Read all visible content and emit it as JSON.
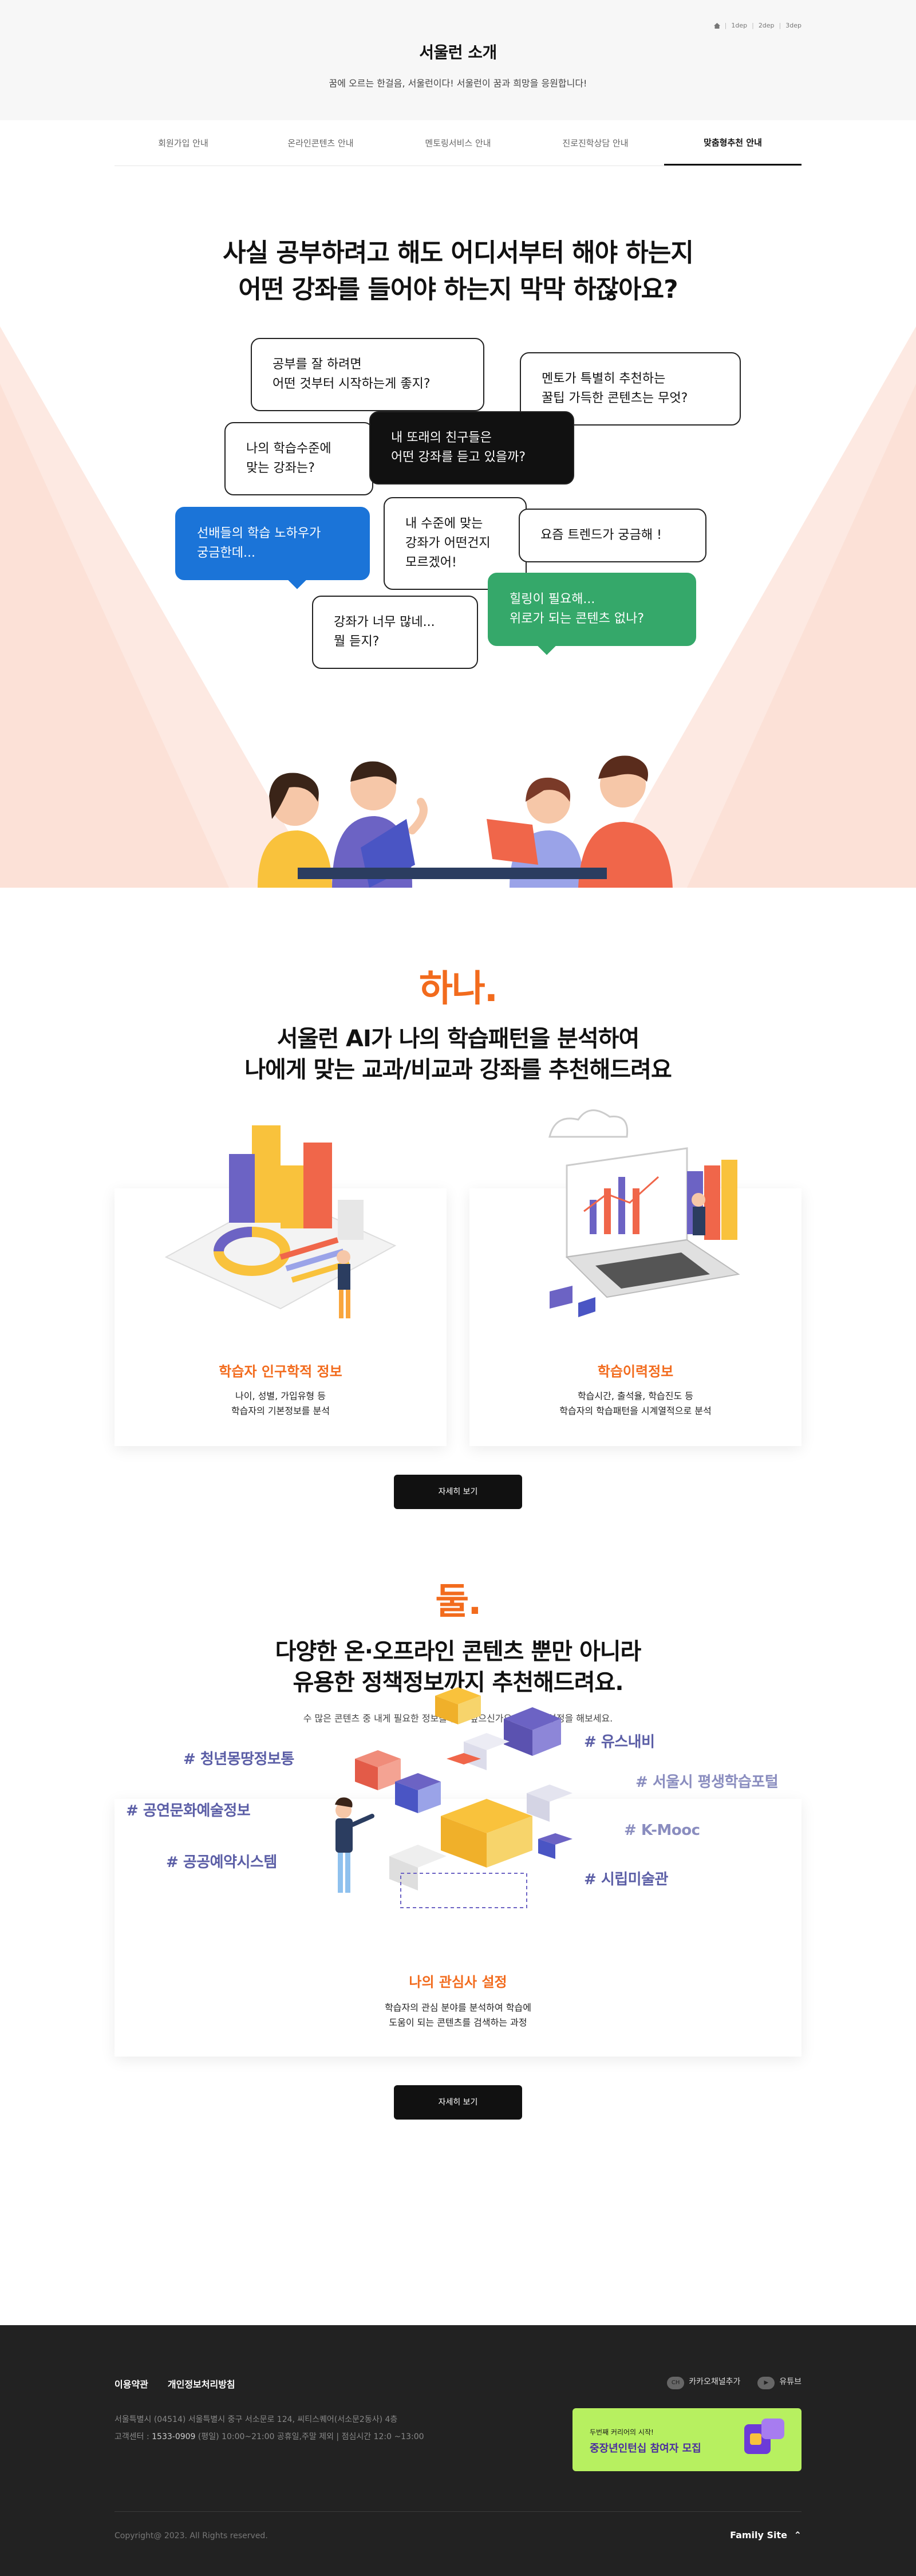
{
  "breadcrumb": [
    "1dep",
    "2dep",
    "3dep"
  ],
  "page": {
    "title": "서울런 소개",
    "subtitle": "꿈에 오르는 한걸음, 서울런이다!  서울런이 꿈과 희망을 응원합니다!"
  },
  "tabs": [
    "회원가입 안내",
    "온라인콘텐츠 안내",
    "멘토링서비스 안내",
    "진로진학상담 안내",
    "맞춤형추천 안내"
  ],
  "hero": {
    "title_line1": "사실 공부하려고 해도 어디서부터 해야 하는지",
    "title_line2": "어떤 강좌를 들어야 하는지 막막 하잖아요?",
    "bubbles": [
      {
        "l1": "공부를 잘 하려면",
        "l2": "어떤 것부터 시작하는게 좋지?"
      },
      {
        "l1": "멘토가 특별히 추천하는",
        "l2": "꿀팁 가득한 콘텐츠는 무엇?"
      },
      {
        "l1": "나의 학습수준에",
        "l2": "맞는 강좌는?"
      },
      {
        "l1": "내 또래의 친구들은",
        "l2": "어떤 강좌를 듣고 있을까?"
      },
      {
        "l1": "선배들의 학습 노하우가",
        "l2": "궁금한데..."
      },
      {
        "l1": "내 수준에 맞는",
        "l2": "강좌가 어떤건지",
        "l3": "모르겠어!"
      },
      {
        "l1": "요즘 트렌드가 궁금해 !"
      },
      {
        "l1": "힐링이 필요해...",
        "l2": "위로가 되는 콘텐츠 없나?"
      },
      {
        "l1": "강좌가 너무 많네...",
        "l2": "뭘 듣지?"
      }
    ]
  },
  "section1": {
    "num": "하나.",
    "title_line1": "서울런 AI가 나의 학습패턴을 분석하여",
    "title_line2": "나에게 맞는 교과/비교과 강좌를 추천해드려요",
    "cards": [
      {
        "title": "학습자 인구학적 정보",
        "desc1": "나이, 성별, 가입유형 등",
        "desc2": "학습자의 기본정보를 분석"
      },
      {
        "title": "학습이력정보",
        "desc1": "학습시간, 출석율, 학습진도 등",
        "desc2": "학습자의 학습패턴을 시계열적으로 분석"
      }
    ],
    "button": "자세히 보기"
  },
  "section2": {
    "num": "둘.",
    "title_line1": "다양한 온·오프라인 콘텐츠 뿐만 아니라",
    "title_line2": "유용한 정책정보까지 추천해드려요.",
    "desc": "수 많은 콘텐츠 중 내게 필요한 정보를 찾고 싶으신가요? 관심사 설정을 해보세요.",
    "tags": [
      "# 청년몽땅정보통",
      "# 공연문화예술정보",
      "# 공공예약시스템",
      "# 유스내비",
      "# 서울시 평생학습포털",
      "# K-Mooc",
      "# 시립미술관"
    ],
    "card_title": "나의 관심사 설정",
    "card_desc1": "학습자의 관심 분야를 분석하여 학습에",
    "card_desc2": "도움이 되는 콘텐츠를 검색하는 과정",
    "button": "자세히 보기"
  },
  "footer": {
    "links": [
      "이용약관",
      "개인정보처리방침"
    ],
    "addr": "서울특별시 (04514) 서울특별시 중구 서소문로 124, 씨티스퀘어(서소문2동사) 4층",
    "center_label": "고객센터 :",
    "center_phone": "1533-0909",
    "center_hours": "(평일) 10:00~21:00 공휴일,주말 제외  |  점심시간 12:0 ~13:00",
    "kakao_label": "카카오채널추가",
    "youtube_label": "유튜브",
    "banner_sub": "두번째 커리어의 시작!",
    "banner_main": "중장년인턴십 참여자 모집",
    "copyright": "Copyright@ 2023. All Rights reserved.",
    "family_site": "Family Site"
  },
  "colors": {
    "accent": "#f26b1d",
    "tag": "#5b5ea6",
    "footer_bg": "#222222",
    "banner": "#b7f060"
  }
}
